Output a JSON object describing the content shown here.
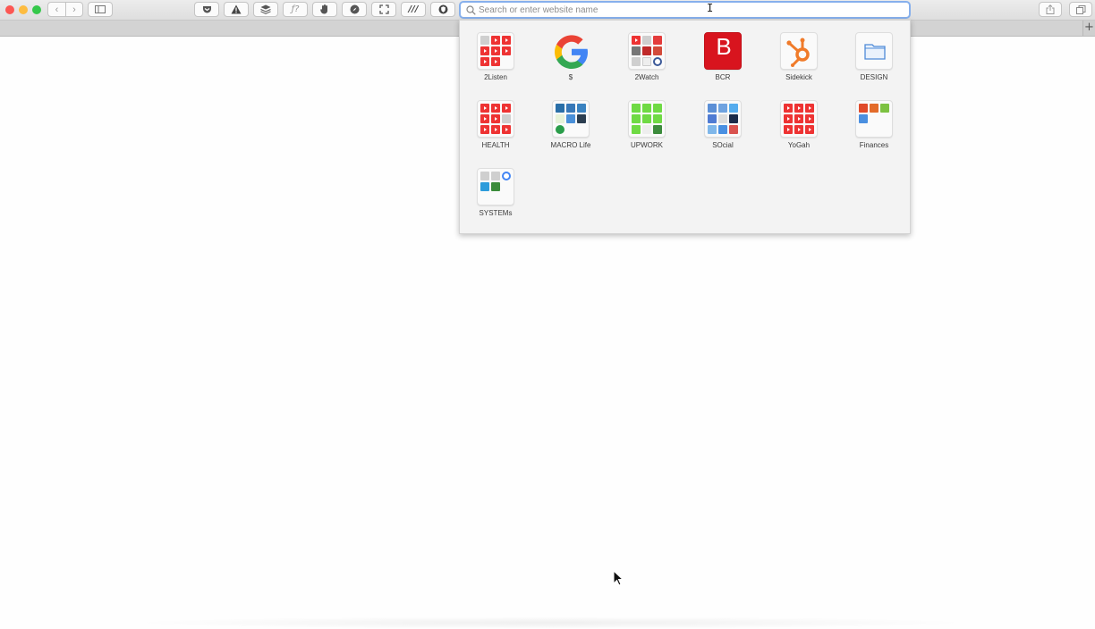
{
  "window": {
    "traffic_lights": [
      {
        "name": "close",
        "color": "#fc5753"
      },
      {
        "name": "minimize",
        "color": "#fdbc40"
      },
      {
        "name": "zoom",
        "color": "#34c84a"
      }
    ]
  },
  "toolbar": {
    "extension_icons": [
      "pocket-icon",
      "warning-icon",
      "layers-icon",
      "fx-icon",
      "hand-icon",
      "compass-icon",
      "fullscreen-icon",
      "slashes-icon",
      "shield-icon"
    ],
    "extension_glyphs": {
      "fx": "ƒ?",
      "slashes": "///"
    }
  },
  "address_bar": {
    "placeholder": "Search or enter website name",
    "value": ""
  },
  "tabstrip": {
    "new_tab_glyph": "+"
  },
  "favorites": [
    {
      "label": "2Listen",
      "type": "folder"
    },
    {
      "label": "$",
      "type": "google"
    },
    {
      "label": "2Watch",
      "type": "folder"
    },
    {
      "label": "BCR",
      "type": "letter",
      "letter": "B",
      "color": "#d8141e"
    },
    {
      "label": "Sidekick",
      "type": "hubspot",
      "color": "#f07b2a"
    },
    {
      "label": "DESIGN",
      "type": "folder-icon"
    },
    {
      "label": "HEALTH",
      "type": "folder"
    },
    {
      "label": "MACRO Life",
      "type": "folder"
    },
    {
      "label": "UPWORK",
      "type": "folder"
    },
    {
      "label": "SOcial",
      "type": "folder"
    },
    {
      "label": "YoGah",
      "type": "folder"
    },
    {
      "label": "Finances",
      "type": "folder"
    },
    {
      "label": "SYSTEMs",
      "type": "folder"
    }
  ],
  "colors": {
    "accent": "#87b0ec",
    "youtube": "#e33333",
    "upwork": "#6fda44"
  }
}
